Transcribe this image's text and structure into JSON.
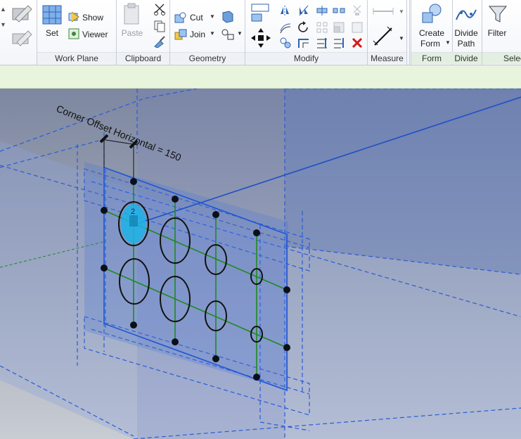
{
  "ribbon": {
    "panels": {
      "work_plane": "Work Plane",
      "clipboard": "Clipboard",
      "geometry": "Geometry",
      "modify": "Modify",
      "measure": "Measure",
      "form": "Form",
      "divide": "Divide",
      "select": "Selec"
    },
    "work_plane": {
      "set": "Set",
      "show": "Show",
      "viewer": "Viewer"
    },
    "clipboard": {
      "paste": "Paste"
    },
    "geometry": {
      "cut": "Cut",
      "join": "Join"
    },
    "form": {
      "create_line1": "Create",
      "create_line2": "Form"
    },
    "divide": {
      "divide_line1": "Divide",
      "divide_line2": "Path"
    },
    "select": {
      "filter": "Filter"
    }
  },
  "viewport": {
    "dimension_label": "Corner Offset Horizontal = 150",
    "control_number": "2"
  },
  "colors": {
    "ribbon_bg": "#ffffff",
    "options_bar": "#e9f4dd",
    "dashed_lines": "#2a5bd7",
    "frame": "#1f55d6",
    "grid": "#1f8a1f",
    "highlight": "#1fb3e6"
  }
}
